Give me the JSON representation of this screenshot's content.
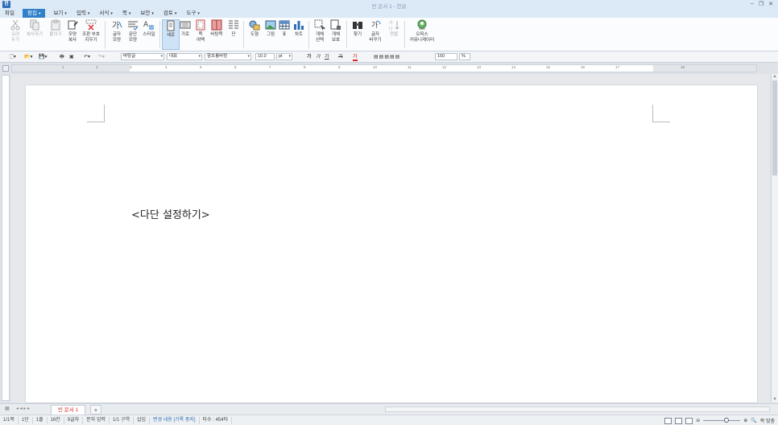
{
  "window": {
    "title": "빈 문서 1 - 한글",
    "logo": "한"
  },
  "menu": {
    "items": [
      {
        "label": "파일",
        "caret": ""
      },
      {
        "label": "편집",
        "caret": "▾"
      },
      {
        "label": "보기",
        "caret": "▾"
      },
      {
        "label": "입력",
        "caret": "▾"
      },
      {
        "label": "서식",
        "caret": "▾"
      },
      {
        "label": "쪽",
        "caret": "▾"
      },
      {
        "label": "보안",
        "caret": "▾"
      },
      {
        "label": "검토",
        "caret": "▾"
      },
      {
        "label": "도구",
        "caret": "▾"
      }
    ]
  },
  "ribbon": {
    "buttons": [
      {
        "label": "오려\n두기",
        "icon": "scissors-icon"
      },
      {
        "label": "복사하기",
        "icon": "copy-icon"
      },
      {
        "label": "붙이기",
        "icon": "paste-icon"
      },
      {
        "label": "모양\n복사",
        "icon": "format-copy-icon"
      },
      {
        "label": "조판 부호\n지우기",
        "icon": "clear-codes-icon"
      },
      {
        "label": "글자\n모양",
        "icon": "char-shape-icon"
      },
      {
        "label": "문단\n모양",
        "icon": "para-shape-icon"
      },
      {
        "label": "스타일",
        "icon": "style-icon"
      },
      {
        "label": "세로",
        "icon": "portrait-icon"
      },
      {
        "label": "가로",
        "icon": "landscape-icon"
      },
      {
        "label": "쪽\n여백",
        "icon": "page-margin-icon"
      },
      {
        "label": "바탕쪽",
        "icon": "master-page-icon"
      },
      {
        "label": "단",
        "icon": "columns-icon"
      },
      {
        "label": "도형",
        "icon": "shape-icon"
      },
      {
        "label": "그림",
        "icon": "picture-icon"
      },
      {
        "label": "표",
        "icon": "table-icon"
      },
      {
        "label": "차트",
        "icon": "chart-icon"
      },
      {
        "label": "개체\n선택",
        "icon": "object-select-icon"
      },
      {
        "label": "개체\n보호",
        "icon": "object-protect-icon"
      },
      {
        "label": "찾기",
        "icon": "binoculars-icon"
      },
      {
        "label": "글자\n바꾸기",
        "icon": "replace-icon"
      },
      {
        "label": "정렬",
        "icon": "sort-icon"
      },
      {
        "label": "오피스\n커뮤니케이터",
        "icon": "communicator-icon"
      }
    ]
  },
  "format_bar": {
    "style": "바탕글",
    "lang": "대표",
    "font": "함초롬바탕",
    "font_size": "10.0",
    "unit": "pt",
    "line_spacing": "160",
    "percent": "%",
    "bold": "가",
    "italic": "가",
    "underline": "가",
    "strike": "가",
    "color": "가"
  },
  "ruler": {
    "numbers": [
      "1",
      "2",
      "3",
      "4",
      "5",
      "6",
      "7",
      "8",
      "9",
      "10",
      "11",
      "12",
      "13",
      "14",
      "15",
      "16",
      "17",
      "18"
    ]
  },
  "document": {
    "text": "<다단 설정하기>"
  },
  "tabbar": {
    "tab_name": "빈 문서 1",
    "add": "+"
  },
  "status": {
    "items": [
      "1/1쪽",
      "1단",
      "1줄",
      "16칸",
      "9글자",
      "문자 입력",
      "1/1 구역",
      "삽입"
    ],
    "track": "변경 내용 [기록 중지]",
    "typing": "타수 : 454타",
    "zoom_label": "쪽 맞춤"
  }
}
